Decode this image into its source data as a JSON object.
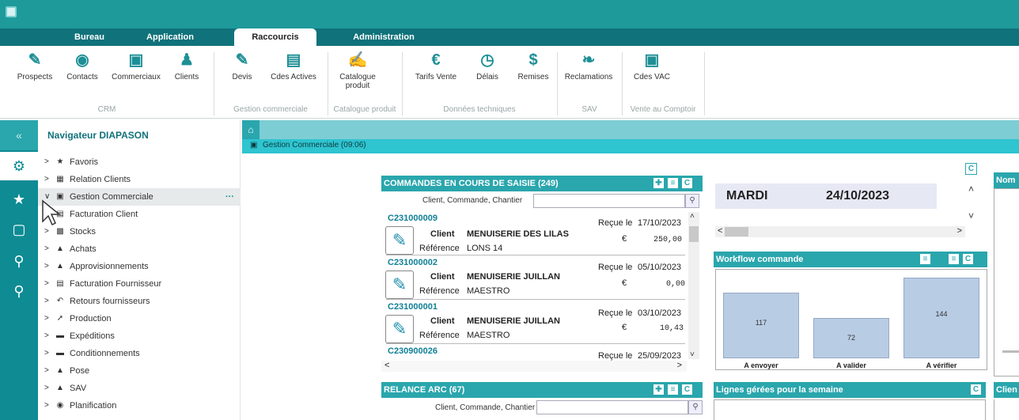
{
  "menu": {
    "tabs": [
      {
        "label": "Bureau"
      },
      {
        "label": "Application"
      },
      {
        "label": "Raccourcis"
      },
      {
        "label": "Administration"
      }
    ]
  },
  "ribbon": {
    "buttons": [
      {
        "label": "Prospects",
        "icon": "handshake-icon"
      },
      {
        "label": "Contacts",
        "icon": "contact-icon"
      },
      {
        "label": "Commerciaux",
        "icon": "briefcase-icon"
      },
      {
        "label": "Clients",
        "icon": "user-icon"
      },
      {
        "label": "Devis",
        "icon": "edit-icon"
      },
      {
        "label": "Cdes Actives",
        "icon": "clipboard-icon"
      },
      {
        "label": "Catalogue produit",
        "icon": "catalog-icon"
      },
      {
        "label": "Tarifs Vente",
        "icon": "euro-doc-icon"
      },
      {
        "label": "Délais",
        "icon": "clock-icon"
      },
      {
        "label": "Remises",
        "icon": "dollar-icon"
      },
      {
        "label": "Reclamations",
        "icon": "leaf-icon"
      },
      {
        "label": "Cdes VAC",
        "icon": "briefcase-icon"
      }
    ],
    "groups": {
      "crm": "CRM",
      "gestion": "Gestion commerciale",
      "catalogue": "Catalogue produit",
      "donnees": "Données techniques",
      "sav": "SAV",
      "vente": "Vente au Comptoir"
    }
  },
  "navigator": {
    "title": "Navigateur DIAPASON",
    "items": [
      {
        "label": "Favoris"
      },
      {
        "label": "Relation Clients"
      },
      {
        "label": "Gestion Commerciale"
      },
      {
        "label": "Facturation Client"
      },
      {
        "label": "Stocks"
      },
      {
        "label": "Achats"
      },
      {
        "label": "Approvisionnements"
      },
      {
        "label": "Facturation Fournisseur"
      },
      {
        "label": "Retours fournisseurs"
      },
      {
        "label": "Production"
      },
      {
        "label": "Expéditions"
      },
      {
        "label": "Conditionnements"
      },
      {
        "label": "Pose"
      },
      {
        "label": "SAV"
      },
      {
        "label": "Planification"
      }
    ],
    "more": "···"
  },
  "content": {
    "subtab": "Gestion Commerciale (09:06)"
  },
  "commandes": {
    "title": "COMMANDES EN COURS  DE SAISIE (249)",
    "search_label": "Client, Commande, Chantier",
    "client_label": "Client",
    "reference_label": "Référence",
    "recue_label": "Reçue le",
    "currency": "€",
    "rows": [
      {
        "code": "C231000009",
        "client": "MENUISERIE DES LILAS",
        "reference": "LONS 14",
        "date": "17/10/2023",
        "amount": "250,00"
      },
      {
        "code": "C231000002",
        "client": "MENUISERIE JUILLAN",
        "reference": "MAESTRO",
        "date": "05/10/2023",
        "amount": "0,00"
      },
      {
        "code": "C231000001",
        "client": "MENUISERIE JUILLAN",
        "reference": "MAESTRO",
        "date": "03/10/2023",
        "amount": "10,43"
      },
      {
        "code": "C230900026",
        "date": "25/09/2023"
      }
    ]
  },
  "relance": {
    "title": "RELANCE ARC (67)",
    "search_label": "Client, Commande, Chantier"
  },
  "date_widget": {
    "day": "MARDI",
    "date": "24/10/2023"
  },
  "workflow": {
    "title": "Workflow commande"
  },
  "chart_data": {
    "type": "bar",
    "title": "Workflow commande",
    "categories": [
      "A envoyer",
      "A valider",
      "A vérifier"
    ],
    "values": [
      117,
      72,
      144
    ],
    "ylim": [
      0,
      150
    ],
    "grid": false,
    "bar_color": "#b8cce4"
  },
  "lignes": {
    "title": "Lignes gérées pour la semaine"
  },
  "right_partial": {
    "nom": "Nom",
    "clien": "Clien"
  },
  "colors": {
    "teal": "#1e9a9a",
    "dark_teal": "#10727a",
    "panel_header": "#2aa6ad"
  }
}
